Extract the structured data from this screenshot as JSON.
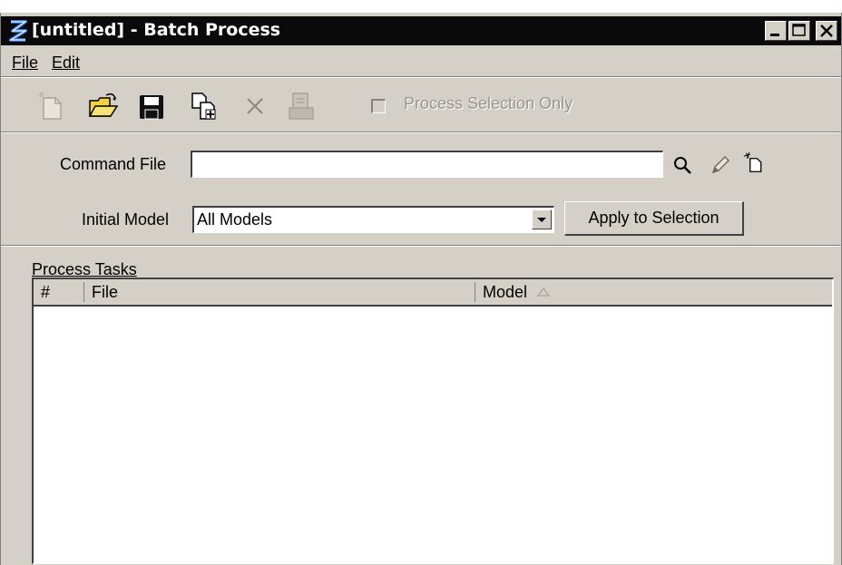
{
  "window": {
    "title": "[untitled] - Batch Process",
    "controls": [
      "minimize-icon",
      "maximize-icon",
      "close-icon"
    ]
  },
  "menu": {
    "items": [
      {
        "label": "File"
      },
      {
        "label": "Edit"
      }
    ]
  },
  "toolbar": {
    "tools": [
      "new-file-icon",
      "open-folder-icon",
      "save-icon",
      "add-files-icon",
      "delete-icon",
      "process-icon"
    ],
    "process_selection_only": {
      "label": "Process Selection Only",
      "checked": false,
      "enabled": false
    }
  },
  "form": {
    "command_file": {
      "label": "Command File",
      "value": ""
    },
    "initial_model": {
      "label": "Initial Model",
      "value": "All Models"
    },
    "apply_button": "Apply to Selection"
  },
  "tasks": {
    "title": "Process Tasks",
    "columns": [
      {
        "label": "#"
      },
      {
        "label": "File"
      },
      {
        "label": "Model"
      }
    ],
    "rows": []
  }
}
